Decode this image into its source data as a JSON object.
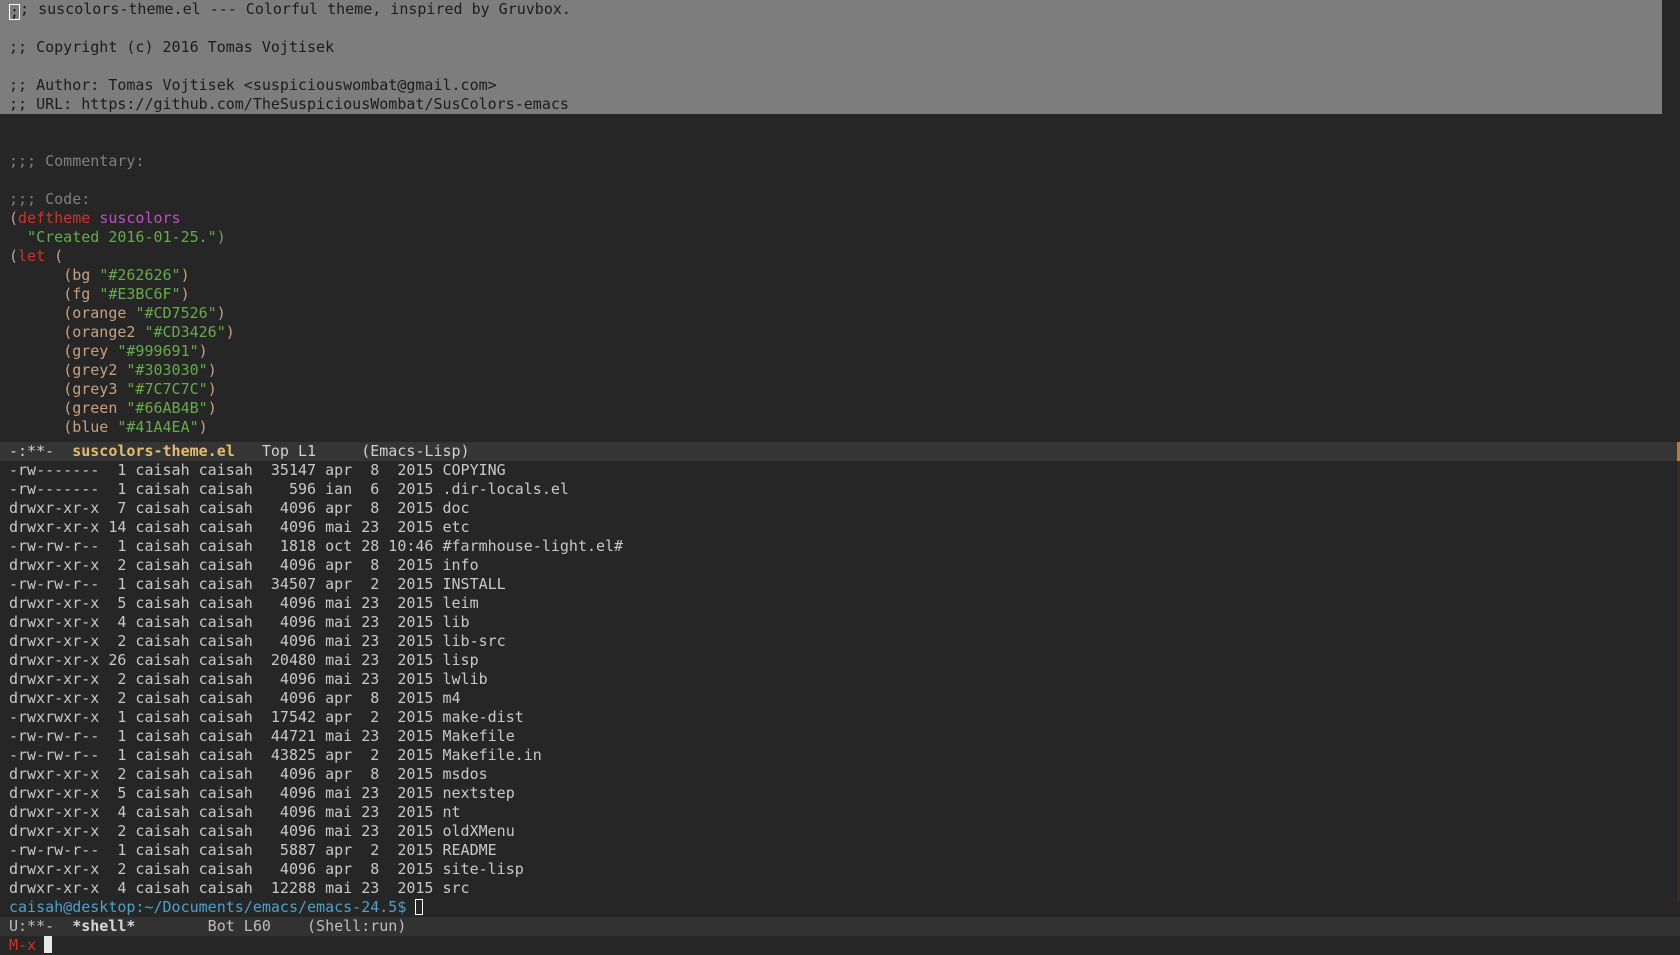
{
  "editor": {
    "header_lines": [
      ";; suscolors-theme.el --- Colorful theme, inspired by Gruvbox.",
      "",
      ";; Copyright (c) 2016 Tomas Vojtisek",
      "",
      ";; Author: Tomas Vojtisek <suspiciouswombat@gmail.com>",
      ";; URL: https://github.com/TheSuspiciousWombat/SusColors-emacs"
    ],
    "commentary": ";;; Commentary:",
    "code_header": ";;; Code:",
    "deftheme_open": "(",
    "deftheme_kw": "deftheme",
    "deftheme_name": "suscolors",
    "created_str": "\"Created 2016-01-25.\")",
    "let_open": "(",
    "let_kw": "let",
    "let_rest": " (",
    "bindings": [
      {
        "name": "bg",
        "value": "\"#262626\""
      },
      {
        "name": "fg",
        "value": "\"#E3BC6F\""
      },
      {
        "name": "orange",
        "value": "\"#CD7526\""
      },
      {
        "name": "orange2",
        "value": "\"#CD3426\""
      },
      {
        "name": "grey",
        "value": "\"#999691\""
      },
      {
        "name": "grey2",
        "value": "\"#303030\""
      },
      {
        "name": "grey3",
        "value": "\"#7C7C7C\""
      },
      {
        "name": "green",
        "value": "\"#66AB4B\""
      },
      {
        "name": "blue",
        "value": "\"#41A4EA\""
      }
    ]
  },
  "modeline_editor": {
    "status": "-:**-  ",
    "buffer": "suscolors-theme.el",
    "position": "   Top L1     ",
    "mode": "(Emacs-Lisp)"
  },
  "shell": {
    "listing": [
      "-rw-------  1 caisah caisah  35147 apr  8  2015 COPYING",
      "-rw-------  1 caisah caisah    596 ian  6  2015 .dir-locals.el",
      "drwxr-xr-x  7 caisah caisah   4096 apr  8  2015 doc",
      "drwxr-xr-x 14 caisah caisah   4096 mai 23  2015 etc",
      "-rw-rw-r--  1 caisah caisah   1818 oct 28 10:46 #farmhouse-light.el#",
      "drwxr-xr-x  2 caisah caisah   4096 apr  8  2015 info",
      "-rw-rw-r--  1 caisah caisah  34507 apr  2  2015 INSTALL",
      "drwxr-xr-x  5 caisah caisah   4096 mai 23  2015 leim",
      "drwxr-xr-x  4 caisah caisah   4096 mai 23  2015 lib",
      "drwxr-xr-x  2 caisah caisah   4096 mai 23  2015 lib-src",
      "drwxr-xr-x 26 caisah caisah  20480 mai 23  2015 lisp",
      "drwxr-xr-x  2 caisah caisah   4096 mai 23  2015 lwlib",
      "drwxr-xr-x  2 caisah caisah   4096 apr  8  2015 m4",
      "-rwxrwxr-x  1 caisah caisah  17542 apr  2  2015 make-dist",
      "-rw-rw-r--  1 caisah caisah  44721 mai 23  2015 Makefile",
      "-rw-rw-r--  1 caisah caisah  43825 apr  2  2015 Makefile.in",
      "drwxr-xr-x  2 caisah caisah   4096 apr  8  2015 msdos",
      "drwxr-xr-x  5 caisah caisah   4096 mai 23  2015 nextstep",
      "drwxr-xr-x  4 caisah caisah   4096 mai 23  2015 nt",
      "drwxr-xr-x  2 caisah caisah   4096 mai 23  2015 oldXMenu",
      "-rw-rw-r--  1 caisah caisah   5887 apr  2  2015 README",
      "drwxr-xr-x  2 caisah caisah   4096 apr  8  2015 site-lisp",
      "drwxr-xr-x  4 caisah caisah  12288 mai 23  2015 src"
    ],
    "prompt": "caisah@desktop:~/Documents/emacs/emacs-24.5$ "
  },
  "modeline_shell": {
    "status": "U:**-  ",
    "buffer": "*shell*",
    "position": "        Bot L60    ",
    "mode": "(Shell:run)"
  },
  "minibuffer": {
    "text": "M-x"
  },
  "colors": {
    "bg": "#262626",
    "region": "#7d7d7d",
    "keyword": "#CD3426",
    "string": "#66AB4B",
    "function": "#c050c0",
    "buffer_name": "#E3BC6F",
    "prompt": "#4fa0c8",
    "fringe_accent": "#CD7526"
  }
}
